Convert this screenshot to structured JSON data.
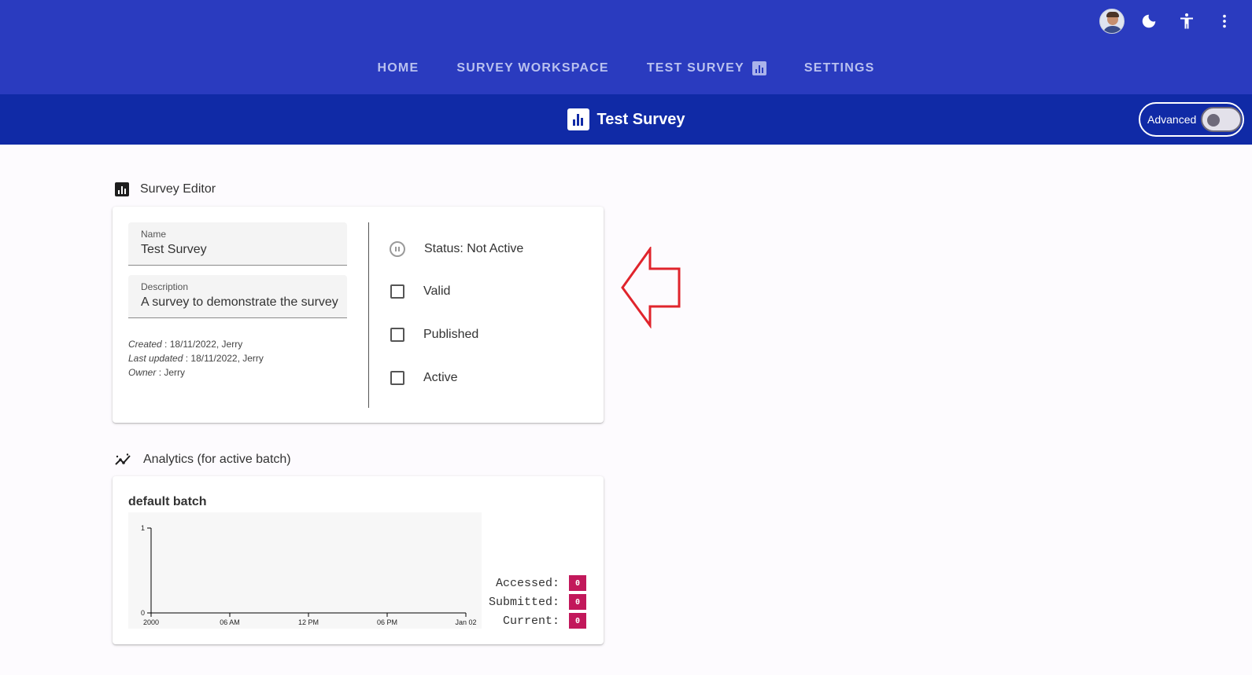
{
  "header": {
    "nav": [
      {
        "label": "HOME",
        "active": false
      },
      {
        "label": "SURVEY WORKSPACE",
        "active": false
      },
      {
        "label": "TEST SURVEY",
        "active": true,
        "icon": "bar-chart-icon"
      },
      {
        "label": "SETTINGS",
        "active": false
      }
    ],
    "actions": [
      "avatar",
      "dark-mode-icon",
      "accessibility-icon",
      "more-vert-icon"
    ]
  },
  "titlebar": {
    "title": "Test Survey",
    "icon": "bar-chart-icon",
    "advanced_label": "Advanced",
    "advanced_on": false
  },
  "editor": {
    "heading": "Survey Editor",
    "name": {
      "label": "Name",
      "value": "Test Survey"
    },
    "description": {
      "label": "Description",
      "value": "A survey to demonstrate the survey"
    },
    "meta": {
      "created_label": "Created",
      "created_value": ": 18/11/2022, Jerry",
      "updated_label": "Last updated",
      "updated_value": ": 18/11/2022, Jerry",
      "owner_label": "Owner",
      "owner_value": ": Jerry"
    },
    "status": "Status: Not Active",
    "checks": [
      {
        "label": "Valid",
        "checked": false
      },
      {
        "label": "Published",
        "checked": false
      },
      {
        "label": "Active",
        "checked": false
      }
    ]
  },
  "analytics": {
    "heading": "Analytics (for active batch)",
    "batch_title": "default batch",
    "stats": [
      {
        "label": "Accessed:",
        "value": "0"
      },
      {
        "label": "Submitted:",
        "value": "0"
      },
      {
        "label": "Current:",
        "value": "0"
      }
    ]
  },
  "chart_data": {
    "type": "line",
    "title": "",
    "xlabel": "",
    "ylabel": "",
    "x_ticks": [
      "2000",
      "06 AM",
      "12 PM",
      "06 PM",
      "Jan 02"
    ],
    "y_ticks": [
      "0",
      "1"
    ],
    "ylim": [
      0,
      1
    ],
    "series": [],
    "grid": false
  },
  "colors": {
    "appbar": "#2a3bbf",
    "titlebar": "#102aa6",
    "badge": "#c2185b",
    "annotation_arrow": "#e0242c"
  }
}
